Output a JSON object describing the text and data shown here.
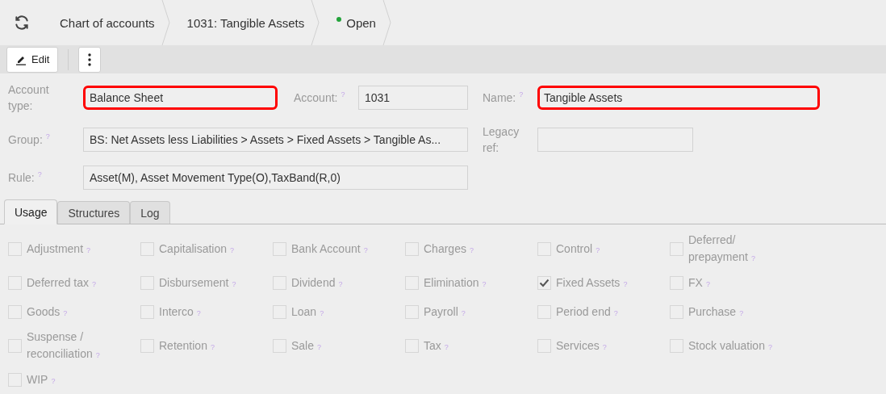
{
  "breadcrumb": {
    "items": [
      {
        "kind": "text",
        "label": "Chart of accounts"
      },
      {
        "kind": "text",
        "label": "1031: Tangible Assets"
      },
      {
        "kind": "status",
        "label": "Open",
        "color": "#22a33a"
      }
    ]
  },
  "toolbar": {
    "edit_label": "Edit"
  },
  "form": {
    "fields": [
      {
        "label": "Account type:",
        "value": "Balance Sheet",
        "highlighted": true
      },
      {
        "label": "Account:",
        "help": "?",
        "value": "1031",
        "highlighted": false
      },
      {
        "label": "Name:",
        "help": "?",
        "value": "Tangible Assets",
        "highlighted": true
      },
      {
        "label": "Group:",
        "help": "?",
        "value": "BS: Net Assets less Liabilities > Assets > Fixed Assets > Tangible As...",
        "highlighted": false
      },
      {
        "label": "Legacy ref:",
        "highlighted": false
      },
      {
        "label": "Rule:",
        "help": "?",
        "value": "Asset(M), Asset Movement Type(O),TaxBand(R,0)",
        "highlighted": false
      }
    ]
  },
  "tabs": [
    {
      "label": "Usage",
      "selected": true
    },
    {
      "label": "Structures",
      "selected": false
    },
    {
      "label": "Log",
      "selected": false
    }
  ],
  "usage": [
    {
      "label": "Adjustment",
      "help": "?",
      "checked": false
    },
    {
      "label": "Capitalisation",
      "help": "?",
      "checked": false
    },
    {
      "label": "Bank Account",
      "help": "?",
      "checked": false
    },
    {
      "label": "Charges",
      "help": "?",
      "checked": false
    },
    {
      "label": "Control",
      "help": "?",
      "checked": false
    },
    {
      "label": "Deferred/ prepayment",
      "help": "?",
      "checked": false
    },
    {
      "label": "Deferred tax",
      "help": "?",
      "checked": false
    },
    {
      "label": "Disbursement",
      "help": "?",
      "checked": false
    },
    {
      "label": "Dividend",
      "help": "?",
      "checked": false
    },
    {
      "label": "Elimination",
      "help": "?",
      "checked": false
    },
    {
      "label": "Fixed Assets",
      "help": "?",
      "checked": true
    },
    {
      "label": "FX",
      "help": "?",
      "checked": false
    },
    {
      "label": "Goods",
      "help": "?",
      "checked": false
    },
    {
      "label": "Interco",
      "help": "?",
      "checked": false
    },
    {
      "label": "Loan",
      "help": "?",
      "checked": false
    },
    {
      "label": "Payroll",
      "help": "?",
      "checked": false
    },
    {
      "label": "Period end",
      "help": "?",
      "checked": false
    },
    {
      "label": "Purchase",
      "help": "?",
      "checked": false
    },
    {
      "label": "Suspense / reconciliation",
      "help": "?",
      "checked": false
    },
    {
      "label": "Retention",
      "help": "?",
      "checked": false
    },
    {
      "label": "Sale",
      "help": "?",
      "checked": false
    },
    {
      "label": "Tax",
      "help": "?",
      "checked": false
    },
    {
      "label": "Services",
      "help": "?",
      "checked": false
    },
    {
      "label": "Stock valuation",
      "help": "?",
      "checked": false
    },
    {
      "label": "WIP",
      "help": "?",
      "checked": false
    }
  ]
}
